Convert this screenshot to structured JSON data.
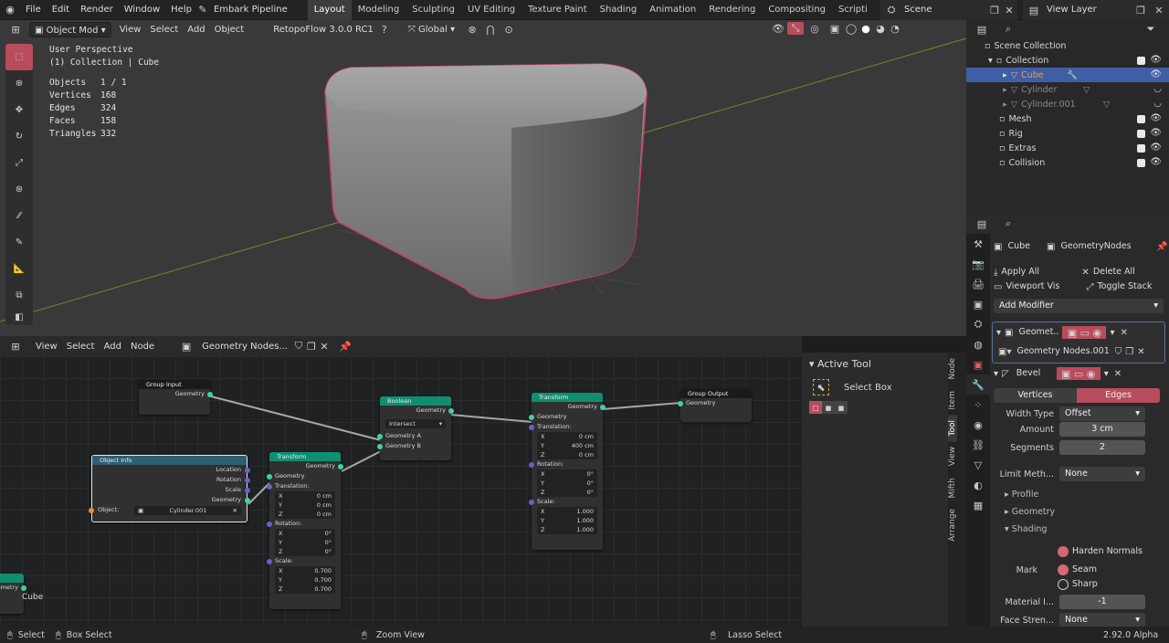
{
  "topbar": {
    "menus": [
      "File",
      "Edit",
      "Render",
      "Window",
      "Help"
    ],
    "pipeline": "Embark Pipeline",
    "workspaces": [
      "Layout",
      "Modeling",
      "Sculpting",
      "UV Editing",
      "Texture Paint",
      "Shading",
      "Animation",
      "Rendering",
      "Compositing",
      "Scripti"
    ],
    "active_workspace": "Layout",
    "scene": "Scene",
    "view_layer": "View Layer"
  },
  "viewport": {
    "mode": "Object Mod",
    "menus": [
      "View",
      "Select",
      "Add",
      "Object"
    ],
    "addon": "RetopoFlow 3.0.0 RC1",
    "orientation": "Global",
    "info": {
      "perspective": "User Perspective",
      "collection": "(1) Collection | Cube",
      "stats": [
        {
          "label": "Objects",
          "value": "1 / 1"
        },
        {
          "label": "Vertices",
          "value": "168"
        },
        {
          "label": "Edges",
          "value": "324"
        },
        {
          "label": "Faces",
          "value": "158"
        },
        {
          "label": "Triangles",
          "value": "332"
        }
      ]
    }
  },
  "node_editor": {
    "menus": [
      "View",
      "Select",
      "Add",
      "Node"
    ],
    "tree_name": "Geometry Nodes...",
    "nodes": {
      "group_input": {
        "title": "Group Input",
        "out": "Geometry"
      },
      "boolean": {
        "title": "Boolean",
        "out": "Geometry",
        "op": "Intersect",
        "in_a": "Geometry A",
        "in_b": "Geometry B"
      },
      "transform1": {
        "title": "Transform",
        "out": "Geometry",
        "in": "Geometry",
        "translation": "Translation:",
        "tx": "0 cm",
        "ty": "400 cm",
        "tz": "0 cm",
        "rotation": "Rotation:",
        "rx": "0°",
        "ry": "0°",
        "rz": "0°",
        "scale": "Scale:",
        "sx": "1.000",
        "sy": "1.000",
        "sz": "1.000"
      },
      "group_output": {
        "title": "Group Output",
        "in": "Geometry"
      },
      "object_info": {
        "title": "Object Info",
        "location": "Location",
        "rotation": "Rotation",
        "scale": "Scale",
        "geometry": "Geometry",
        "object_label": "Object:",
        "object_value": "Cylinder.001"
      },
      "transform2": {
        "title": "Transform",
        "out": "Geometry",
        "in": "Geometry",
        "translation": "Translation:",
        "tx": "0 cm",
        "ty": "0 cm",
        "tz": "0 cm",
        "rotation": "Rotation:",
        "rx": "0°",
        "ry": "0°",
        "rz": "0°",
        "scale": "Scale:",
        "sx": "0.700",
        "sy": "0.700",
        "sz": "0.700"
      },
      "partial": {
        "out": "Geometry",
        "label": "Cube"
      }
    },
    "axis_labels": {
      "x": "X",
      "y": "Y",
      "z": "Z"
    }
  },
  "active_tool": {
    "title": "Active Tool",
    "tool": "Select Box"
  },
  "side_tabs": [
    "Node",
    "Item",
    "Tool",
    "View",
    "Mifth",
    "Arrange"
  ],
  "outliner": {
    "root": "Scene Collection",
    "items": [
      {
        "name": "Collection",
        "level": 1,
        "checked": true
      },
      {
        "name": "Cube",
        "level": 2,
        "selected": true
      },
      {
        "name": "Cylinder",
        "level": 2,
        "dim": true
      },
      {
        "name": "Cylinder.001",
        "level": 2,
        "dim": true
      },
      {
        "name": "Mesh",
        "level": 1,
        "checked": true
      },
      {
        "name": "Rig",
        "level": 1,
        "checked": true
      },
      {
        "name": "Extras",
        "level": 1,
        "checked": true
      },
      {
        "name": "Collision",
        "level": 1,
        "checked": true
      }
    ]
  },
  "properties": {
    "object": "Cube",
    "modifier_name": "GeometryNodes",
    "apply_all": "Apply All",
    "delete_all": "Delete All",
    "viewport_vis": "Viewport Vis",
    "toggle_stack": "Toggle Stack",
    "add_modifier": "Add Modifier",
    "geo_mod": "Geomet...",
    "geo_tree": "Geometry Nodes.001",
    "bevel": "Bevel",
    "vertices": "Vertices",
    "edges": "Edges",
    "width_type_label": "Width Type",
    "width_type": "Offset",
    "amount_label": "Amount",
    "amount": "3 cm",
    "segments_label": "Segments",
    "segments": "2",
    "limit_label": "Limit Meth...",
    "limit": "None",
    "profile": "Profile",
    "geometry": "Geometry",
    "shading": "Shading",
    "harden": "Harden Normals",
    "mark_label": "Mark",
    "seam": "Seam",
    "sharp": "Sharp",
    "material_label": "Material I...",
    "material": "-1",
    "face_label": "Face Stren...",
    "face": "None"
  },
  "statusbar": {
    "select": "Select",
    "box_select": "Box Select",
    "zoom": "Zoom View",
    "lasso": "Lasso Select",
    "version": "2.92.0 Alpha"
  },
  "colors": {
    "accent": "#b94c5c",
    "node_green": "#0f8f70",
    "selection": "#3f5ea6"
  }
}
